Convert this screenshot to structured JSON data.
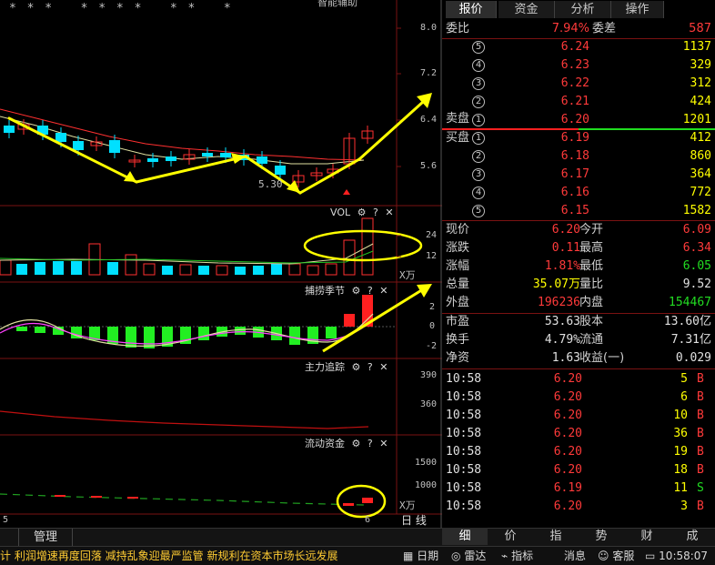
{
  "chart": {
    "stars": "* * *   * * * *   * *   *",
    "top_label": "智能辅助",
    "price_axis": [
      "8.0",
      "7.2",
      "6.4",
      "5.6"
    ],
    "low_label": "5.30",
    "vol_title": "VOL",
    "vol_axis": [
      "24",
      "12"
    ],
    "vol_unit": "X万",
    "ind1_title": "捕捞季节",
    "ind1_axis": [
      "2",
      "0",
      "-2"
    ],
    "ind2_title": "主力追踪",
    "ind2_axis": [
      "390",
      "360"
    ],
    "ind3_title": "流动资金",
    "ind3_axis": [
      "1500",
      "1000"
    ],
    "ind3_unit": "X万",
    "bottom_left_num": "5",
    "bottom_right_num": "6",
    "period_label": "日 线",
    "manage_label": "管理"
  },
  "quote": {
    "tabs": [
      "报价",
      "资金",
      "分析",
      "操作"
    ],
    "weibi_label": "委比",
    "weibi_value": "7.94%",
    "weicha_label": "委差",
    "weicha_value": "587",
    "sell_label": "卖盘",
    "buy_label": "买盘",
    "sells": [
      {
        "n": "5",
        "price": "6.24",
        "vol": "1137"
      },
      {
        "n": "4",
        "price": "6.23",
        "vol": "329"
      },
      {
        "n": "3",
        "price": "6.22",
        "vol": "312"
      },
      {
        "n": "2",
        "price": "6.21",
        "vol": "424"
      },
      {
        "n": "1",
        "price": "6.20",
        "vol": "1201"
      }
    ],
    "buys": [
      {
        "n": "1",
        "price": "6.19",
        "vol": "412"
      },
      {
        "n": "2",
        "price": "6.18",
        "vol": "860"
      },
      {
        "n": "3",
        "price": "6.17",
        "vol": "364"
      },
      {
        "n": "4",
        "price": "6.16",
        "vol": "772"
      },
      {
        "n": "5",
        "price": "6.15",
        "vol": "1582"
      }
    ],
    "stats": [
      {
        "l1": "现价",
        "v1": "6.20",
        "l2": "今开",
        "v2": "6.09"
      },
      {
        "l1": "涨跌",
        "v1": "0.11",
        "l2": "最高",
        "v2": "6.34"
      },
      {
        "l1": "涨幅",
        "v1": "1.81%",
        "l2": "最低",
        "v2": "6.05"
      },
      {
        "l1": "总量",
        "v1": "35.07万",
        "l2": "量比",
        "v2": "9.52"
      },
      {
        "l1": "外盘",
        "v1": "196236",
        "l2": "内盘",
        "v2": "154467"
      }
    ],
    "stats2": [
      {
        "l1": "市盈",
        "v1": "53.63",
        "l2": "股本",
        "v2": "13.60亿"
      },
      {
        "l1": "换手",
        "v1": "4.79%",
        "l2": "流通",
        "v2": "7.31亿"
      },
      {
        "l1": "净资",
        "v1": "1.63",
        "l2": "收益(一)",
        "v2": "0.029"
      }
    ],
    "trades": [
      {
        "time": "10:58",
        "price": "6.20",
        "vol": "5",
        "side": "B"
      },
      {
        "time": "10:58",
        "price": "6.20",
        "vol": "6",
        "side": "B"
      },
      {
        "time": "10:58",
        "price": "6.20",
        "vol": "10",
        "side": "B"
      },
      {
        "time": "10:58",
        "price": "6.20",
        "vol": "36",
        "side": "B"
      },
      {
        "time": "10:58",
        "price": "6.20",
        "vol": "19",
        "side": "B"
      },
      {
        "time": "10:58",
        "price": "6.20",
        "vol": "18",
        "side": "B"
      },
      {
        "time": "10:58",
        "price": "6.19",
        "vol": "11",
        "side": "S"
      },
      {
        "time": "10:58",
        "price": "6.20",
        "vol": "3",
        "side": "B"
      }
    ],
    "bottom_tabs": [
      "细",
      "价",
      "指",
      "势",
      "财",
      "成"
    ]
  },
  "status": {
    "ticker": "计 利润增速再度回落    减持乱象迎最严监管  新规利在资本市场长远发展",
    "btn_date": "日期",
    "btn_radar": "雷达",
    "btn_index": "指标",
    "btn_msg": "消息",
    "btn_service": "客服",
    "time": "10:58:07"
  }
}
